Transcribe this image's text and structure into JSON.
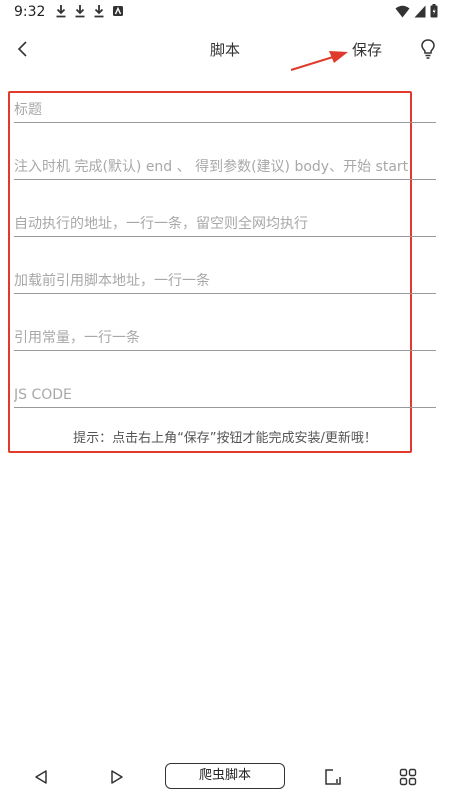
{
  "status_bar": {
    "time": "9:32",
    "left_icons": [
      "download-icon",
      "download-icon",
      "download-icon",
      "app-notification-icon"
    ],
    "right_icons": [
      "wifi-icon",
      "cellular-signal-icon",
      "battery-icon"
    ]
  },
  "header": {
    "title": "脚本",
    "save_label": "保存",
    "back_icon": "chevron-left-icon",
    "tip_icon": "lightbulb-icon"
  },
  "form": {
    "fields": [
      {
        "placeholder": "标题",
        "value": ""
      },
      {
        "placeholder": "注入时机 完成(默认) end 、 得到参数(建议) body、开始 start",
        "value": ""
      },
      {
        "placeholder": "自动执行的地址，一行一条，留空则全网均执行",
        "value": ""
      },
      {
        "placeholder": "加载前引用脚本地址，一行一条",
        "value": ""
      },
      {
        "placeholder": "引用常量，一行一条",
        "value": ""
      },
      {
        "placeholder": "JS CODE",
        "value": ""
      }
    ],
    "hint": "提示：点击右上角“保存”按钮才能完成安装/更新哦！"
  },
  "annotation": {
    "color": "#e03a2c"
  },
  "bottom_bar": {
    "address_label": "爬虫脚本",
    "icons": [
      "back-triangle-icon",
      "forward-triangle-icon",
      "tabs-icon",
      "grid-menu-icon"
    ]
  }
}
